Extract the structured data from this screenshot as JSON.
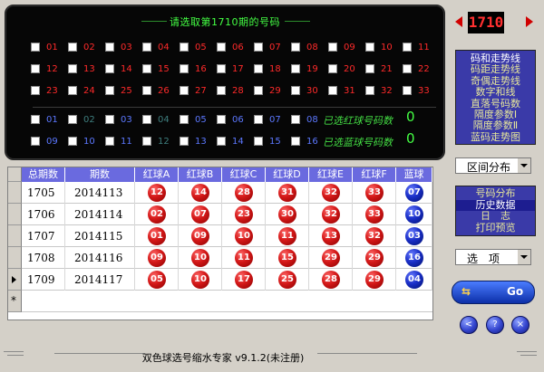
{
  "picker": {
    "title": "请选取第1710期的号码",
    "red_numbers": [
      "01",
      "02",
      "03",
      "04",
      "05",
      "06",
      "07",
      "08",
      "09",
      "10",
      "11",
      "12",
      "13",
      "14",
      "15",
      "16",
      "17",
      "18",
      "19",
      "20",
      "21",
      "22",
      "23",
      "24",
      "25",
      "26",
      "27",
      "28",
      "29",
      "30",
      "31",
      "32",
      "33"
    ],
    "blue_numbers": [
      "01",
      "02",
      "03",
      "04",
      "05",
      "06",
      "07",
      "08",
      "09",
      "10",
      "11",
      "12",
      "13",
      "14",
      "15",
      "16"
    ],
    "red_selected_label": "已选红球号码数",
    "red_selected_count": "0",
    "blue_selected_label": "已选蓝球号码数",
    "blue_selected_count": "0"
  },
  "table": {
    "headers": [
      "总期数",
      "期数",
      "红球A",
      "红球B",
      "红球C",
      "红球D",
      "红球E",
      "红球F",
      "蓝球"
    ],
    "rows": [
      {
        "total": "1705",
        "issue": "2014113",
        "reds": [
          "12",
          "14",
          "28",
          "31",
          "32",
          "33"
        ],
        "blue": "07"
      },
      {
        "total": "1706",
        "issue": "2014114",
        "reds": [
          "02",
          "07",
          "23",
          "30",
          "32",
          "33"
        ],
        "blue": "10"
      },
      {
        "total": "1707",
        "issue": "2014115",
        "reds": [
          "01",
          "09",
          "10",
          "11",
          "13",
          "32"
        ],
        "blue": "03"
      },
      {
        "total": "1708",
        "issue": "2014116",
        "reds": [
          "09",
          "10",
          "11",
          "15",
          "29",
          "29"
        ],
        "blue": "16"
      },
      {
        "total": "1709",
        "issue": "2014117",
        "reds": [
          "05",
          "10",
          "17",
          "25",
          "28",
          "29"
        ],
        "blue": "04"
      }
    ],
    "new_row_marker": "*"
  },
  "side": {
    "issue_display": "1710",
    "menu": [
      "码和走势线",
      "码距走势线",
      "奇偶走势线",
      "数字和线",
      "直落号码数",
      "隔度参数Ⅰ",
      "隔度参数Ⅱ",
      "蓝码走势图"
    ],
    "range_dropdown": "区间分布",
    "history": [
      "号码分布",
      "历史数据",
      "日　志",
      "打印预览"
    ],
    "options_dropdown": "选　项",
    "go_label": "Go",
    "round_buttons": [
      "<",
      "?",
      "×"
    ]
  },
  "footer": {
    "title": "双色球选号缩水专家 v9.1.2(未注册)"
  },
  "colors": {
    "red_ball": "#d41818",
    "blue_ball": "#1a2fc8",
    "header_bg": "#6a6adf",
    "menu_bg": "#3a3aa8"
  }
}
